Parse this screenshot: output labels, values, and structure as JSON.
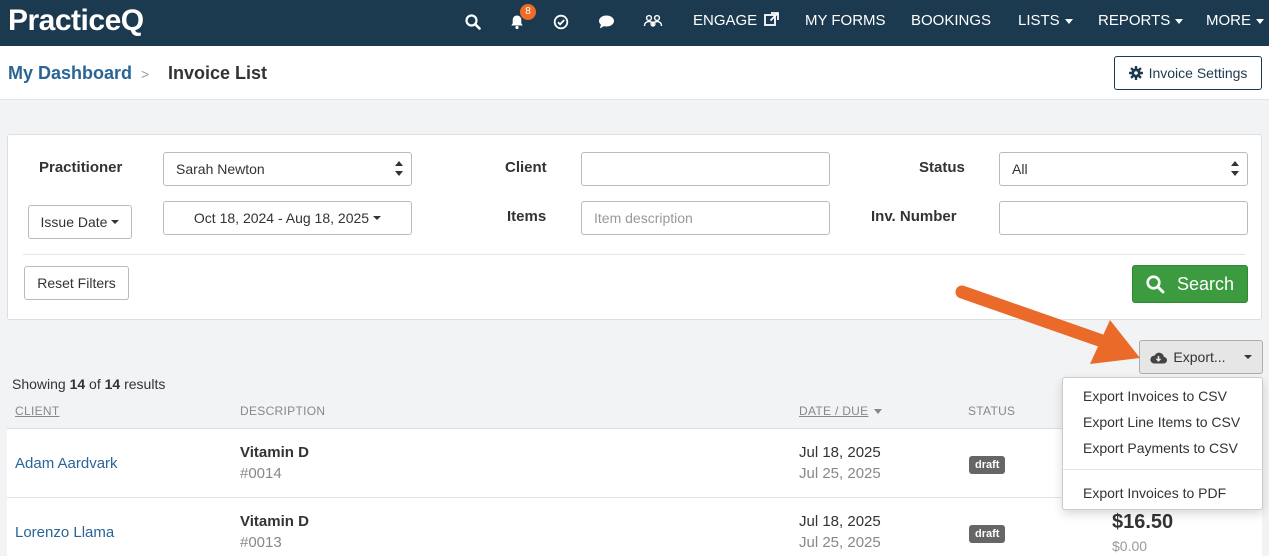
{
  "topnav": {
    "logo_main": "Practice",
    "logo_q": "Q",
    "notification_count": "8",
    "links": {
      "engage": "ENGAGE",
      "my_forms": "MY FORMS",
      "bookings": "BOOKINGS",
      "lists": "LISTS",
      "reports": "REPORTS",
      "more": "MORE"
    }
  },
  "breadcrumb": {
    "parent": "My Dashboard",
    "separator": ">",
    "current": "Invoice List"
  },
  "header": {
    "settings_label": "Invoice Settings"
  },
  "filters": {
    "practitioner_label": "Practitioner",
    "practitioner_value": "Sarah Newton",
    "client_label": "Client",
    "client_value": "",
    "status_label": "Status",
    "status_value": "All",
    "date_type_label": "Issue Date",
    "date_range": "Oct 18, 2024 - Aug 18, 2025",
    "items_label": "Items",
    "items_placeholder": "Item description",
    "inv_number_label": "Inv. Number",
    "inv_number_value": "",
    "reset_label": "Reset Filters",
    "search_label": "Search"
  },
  "export": {
    "button_label": "Export...",
    "menu": [
      "Export Invoices to CSV",
      "Export Line Items to CSV",
      "Export Payments to CSV",
      "Export Invoices to PDF"
    ]
  },
  "results": {
    "prefix": "Showing ",
    "shown": "14",
    "middle": " of ",
    "total": "14",
    "suffix": " results"
  },
  "table": {
    "headers": {
      "client": "CLIENT",
      "description": "DESCRIPTION",
      "date_due": "DATE / DUE",
      "status": "STATUS"
    },
    "rows": [
      {
        "client": "Adam Aardvark",
        "description": "Vitamin D",
        "number": "#0014",
        "date": "Jul 18, 2025",
        "due": "Jul 25, 2025",
        "status": "draft",
        "total": "",
        "paid": ""
      },
      {
        "client": "Lorenzo Llama",
        "description": "Vitamin D",
        "number": "#0013",
        "date": "Jul 18, 2025",
        "due": "Jul 25, 2025",
        "status": "draft",
        "total": "$16.50",
        "paid": "$0.00"
      }
    ]
  },
  "colors": {
    "nav_bg": "#1c3a4f",
    "link": "#2a6496",
    "search_green": "#3c9b3f",
    "badge_orange": "#ef6b2a",
    "arrow_orange": "#ea6a2a"
  }
}
